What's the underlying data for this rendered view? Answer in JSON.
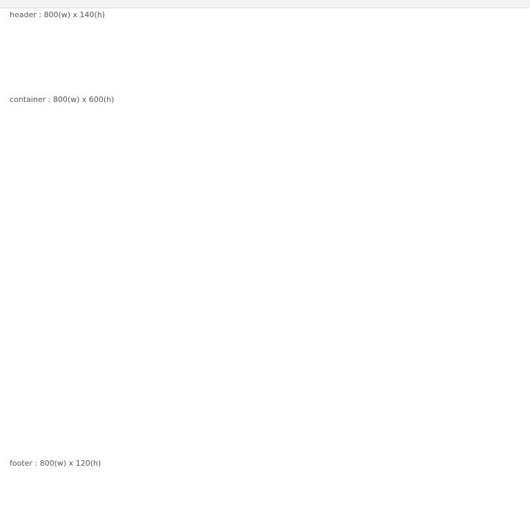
{
  "layout": {
    "header_label": "header : 800(w) x 140(h)",
    "container_label": "container : 800(w) x 600(h)",
    "footer_label": "footer : 800(w) x 120(h)"
  },
  "colors": {
    "page_background": "#ffffff",
    "text": "#555555",
    "chrome_background": "#f3f3f3"
  }
}
